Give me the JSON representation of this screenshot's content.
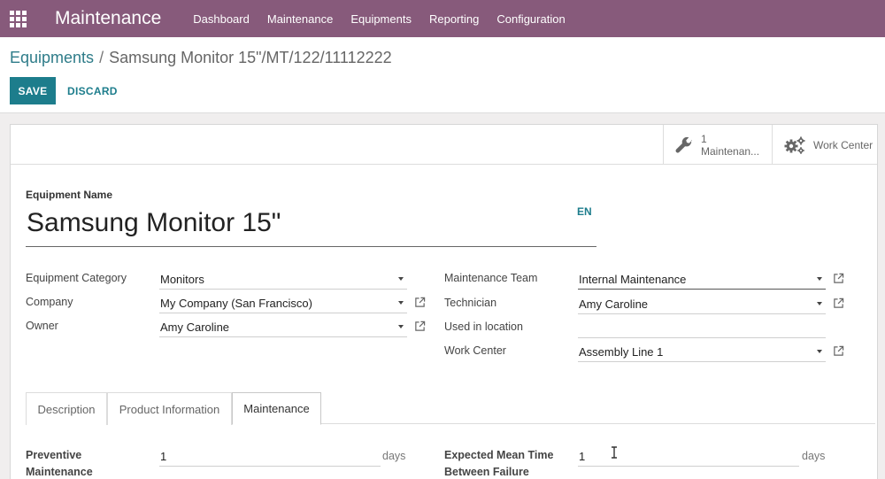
{
  "topbar": {
    "app_title": "Maintenance",
    "menu": [
      "Dashboard",
      "Maintenance",
      "Equipments",
      "Reporting",
      "Configuration"
    ],
    "bg_color": "#875a7b",
    "apps_icon": "grid-icon"
  },
  "breadcrumb": {
    "parent": "Equipments",
    "separator": "/",
    "current": "Samsung Monitor 15\"/MT/122/11112222"
  },
  "actions": {
    "save": "SAVE",
    "discard": "DISCARD",
    "accent": "#1d7d8c"
  },
  "stat_buttons": {
    "maintenance": {
      "count": "1",
      "label": "Maintenan...",
      "icon": "wrench-icon"
    },
    "work_center": {
      "label": "Work Center",
      "icon": "gears-icon"
    }
  },
  "equipment": {
    "name_label": "Equipment Name",
    "name": "Samsung Monitor 15\"",
    "lang": "EN"
  },
  "fields_left": [
    {
      "label": "Equipment Category",
      "value": "Monitors"
    },
    {
      "label": "Company",
      "value": "My Company (San Francisco)"
    },
    {
      "label": "Owner",
      "value": "Amy Caroline"
    }
  ],
  "fields_right": [
    {
      "label": "Maintenance Team",
      "value": "Internal Maintenance"
    },
    {
      "label": "Technician",
      "value": "Amy Caroline"
    },
    {
      "label": "Used in location",
      "value": ""
    },
    {
      "label": "Work Center",
      "value": "Assembly Line 1"
    }
  ],
  "tabs": [
    "Description",
    "Product Information",
    "Maintenance"
  ],
  "active_tab": "Maintenance",
  "maintenance_tab": {
    "preventive_label_line1": "Preventive",
    "preventive_label_line2": "Maintenance",
    "preventive_value": "1",
    "preventive_unit": "days",
    "mtbf_label_line1": "Expected Mean Time",
    "mtbf_label_line2": "Between Failure",
    "mtbf_value": "1",
    "mtbf_unit": "days"
  }
}
